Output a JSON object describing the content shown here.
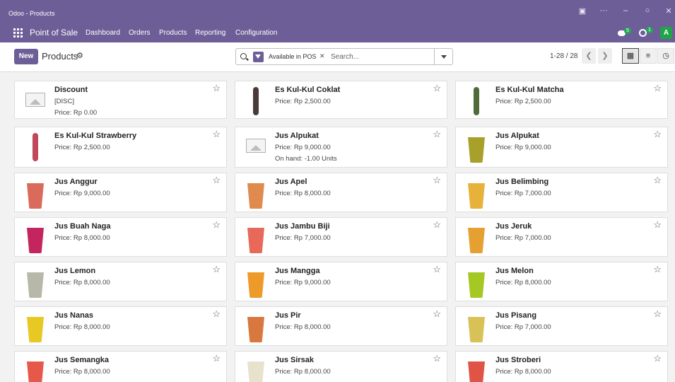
{
  "window": {
    "title": "Odoo - Products"
  },
  "nav": {
    "app_name": "Point of Sale",
    "menu": [
      "Dashboard",
      "Orders",
      "Products",
      "Reporting",
      "Configuration"
    ],
    "messages_badge": "5",
    "activity_badge": "1",
    "avatar_initial": "A"
  },
  "control": {
    "new_label": "New",
    "breadcrumb": "Products",
    "facet": "Available in POS",
    "search_placeholder": "Search...",
    "pager": "1-28 / 28"
  },
  "colors": {
    "brand": "#6e5e98",
    "success": "#1fa855"
  },
  "products": [
    {
      "name": "Discount",
      "line2": "[DISC]",
      "line3": "Price: Rp 0.00",
      "image": "placeholder"
    },
    {
      "name": "Es Kul-Kul Coklat",
      "line2": "Price: Rp 2,500.00",
      "image": "popsicle",
      "color": "#4a3a38"
    },
    {
      "name": "Es Kul-Kul Matcha",
      "line2": "Price: Rp 2,500.00",
      "image": "popsicle",
      "color": "#4f6b3a"
    },
    {
      "name": "Es Kul-Kul Strawberry",
      "line2": "Price: Rp 2,500.00",
      "image": "popsicle",
      "color": "#c0485a"
    },
    {
      "name": "Jus Alpukat",
      "line2": "Price: Rp 9,000.00",
      "line3": "On hand: -1.00 Units",
      "image": "placeholder"
    },
    {
      "name": "Jus Alpukat",
      "line2": "Price: Rp 9,000.00",
      "image": "cup",
      "color": "#a8a02a"
    },
    {
      "name": "Jus Anggur",
      "line2": "Price: Rp 9,000.00",
      "image": "cup",
      "color": "#d96a5c"
    },
    {
      "name": "Jus Apel",
      "line2": "Price: Rp 8,000.00",
      "image": "cup",
      "color": "#e08a4e"
    },
    {
      "name": "Jus Belimbing",
      "line2": "Price: Rp 7,000.00",
      "image": "cup",
      "color": "#e6b23a"
    },
    {
      "name": "Jus Buah Naga",
      "line2": "Price: Rp 8,000.00",
      "image": "cup",
      "color": "#c4255e"
    },
    {
      "name": "Jus Jambu Biji",
      "line2": "Price: Rp 7,000.00",
      "image": "cup",
      "color": "#e8685a"
    },
    {
      "name": "Jus Jeruk",
      "line2": "Price: Rp 7,000.00",
      "image": "cup",
      "color": "#e6a032"
    },
    {
      "name": "Jus Lemon",
      "line2": "Price: Rp 8,000.00",
      "image": "cup",
      "color": "#b8b8a8"
    },
    {
      "name": "Jus Mangga",
      "line2": "Price: Rp 9,000.00",
      "image": "cup",
      "color": "#ee9a2a"
    },
    {
      "name": "Jus Melon",
      "line2": "Price: Rp 8,000.00",
      "image": "cup",
      "color": "#a6c822"
    },
    {
      "name": "Jus Nanas",
      "line2": "Price: Rp 8,000.00",
      "image": "cup",
      "color": "#e8c822"
    },
    {
      "name": "Jus Pir",
      "line2": "Price: Rp 8,000.00",
      "image": "cup",
      "color": "#d8783e"
    },
    {
      "name": "Jus Pisang",
      "line2": "Price: Rp 7,000.00",
      "image": "cup",
      "color": "#d8c258"
    },
    {
      "name": "Jus Semangka",
      "line2": "Price: Rp 8,000.00",
      "image": "cup",
      "color": "#e6584a"
    },
    {
      "name": "Jus Sirsak",
      "line2": "Price: Rp 8,000.00",
      "image": "cup",
      "color": "#e8e2cc"
    },
    {
      "name": "Jus Stroberi",
      "line2": "Price: Rp 8,000.00",
      "image": "cup",
      "color": "#e05446"
    }
  ]
}
